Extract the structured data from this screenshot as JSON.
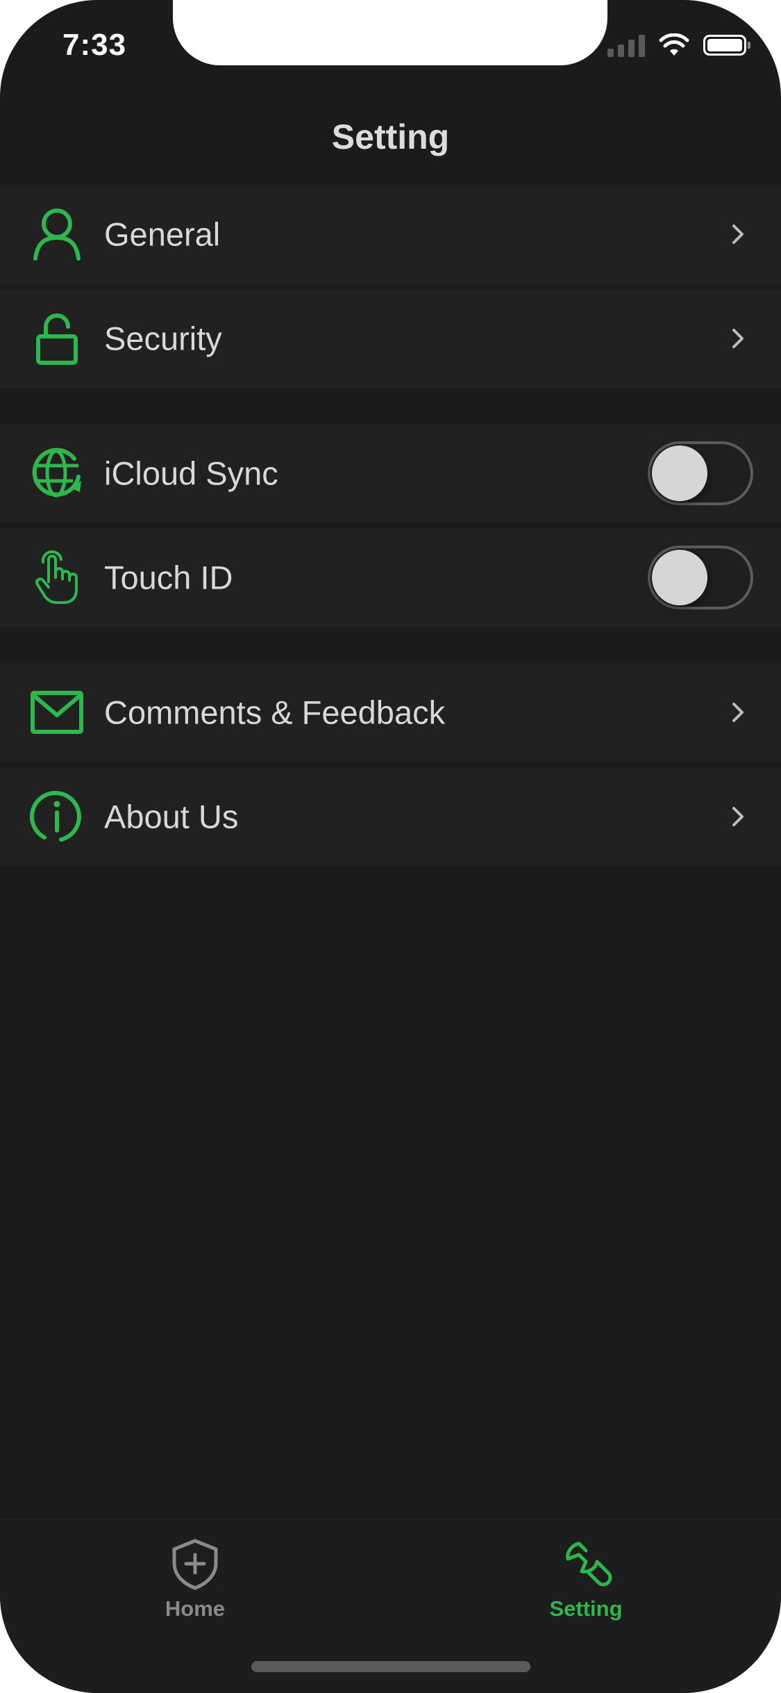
{
  "status_bar": {
    "time": "7:33"
  },
  "nav": {
    "title": "Setting"
  },
  "sections": {
    "general": {
      "label": "General",
      "icon": "person-icon"
    },
    "security": {
      "label": "Security",
      "icon": "unlock-icon"
    },
    "icloud_sync": {
      "label": "iCloud Sync",
      "icon": "globe-sync-icon",
      "enabled": false
    },
    "touch_id": {
      "label": "Touch ID",
      "icon": "hand-pointer-icon",
      "enabled": false
    },
    "feedback": {
      "label": "Comments & Feedback",
      "icon": "mail-icon"
    },
    "about": {
      "label": "About Us",
      "icon": "info-icon"
    }
  },
  "tabbar": {
    "home": {
      "label": "Home",
      "icon": "shield-plus-icon"
    },
    "setting": {
      "label": "Setting",
      "icon": "wrench-icon",
      "active": true
    }
  },
  "colors": {
    "accent": "#2db84d",
    "background": "#1b1b1b",
    "row_background": "#212121",
    "text": "#d8d8d8",
    "inactive_tab": "#8a8a8a"
  }
}
